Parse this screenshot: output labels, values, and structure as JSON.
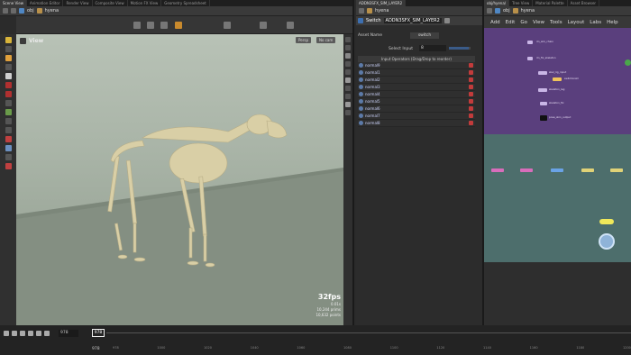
{
  "tabs_left": [
    "Scene View",
    "Animation Editor",
    "Render View",
    "Composite View",
    "Motion FX View",
    "Geometry Spreadsheet"
  ],
  "tabs_mid": [
    "ADDN3SFX_SIM_LAYER2"
  ],
  "tabs_right": [
    "obj/hyena/",
    "Tree View",
    "Material Palette",
    "Asset Browser"
  ],
  "left_path": [
    "obj",
    "hyena"
  ],
  "viewport": {
    "title": "View",
    "persp": "Persp",
    "cam": "No cam",
    "fps": "32fps",
    "time": "0.01s",
    "prims": "10,244 prims",
    "points": "10,632 points"
  },
  "mid_path": [
    "hyena"
  ],
  "param": {
    "node_type": "Switch",
    "node_name": "ADDN3SFX_SIM_LAYER2",
    "asset_label": "Asset Name",
    "asset_value": "switch",
    "select_label": "Select Input",
    "select_value": "8",
    "ops_header": "Input Operators (Drag/Drop to reorder)",
    "inputs": [
      "normal9",
      "normal1",
      "normal2",
      "normal3",
      "normal4",
      "normal5",
      "normal6",
      "normal7",
      "normal8"
    ]
  },
  "right_path": [
    "obj",
    "hyena"
  ],
  "menu": [
    "Add",
    "Edit",
    "Go",
    "View",
    "Tools",
    "Layout",
    "Labs",
    "Help"
  ],
  "graph_nodes": [
    "dn_sim_chain",
    "dn_fix_skeleton",
    "skel_rig_input",
    "switchAnim",
    "skeleton_leg",
    "skeleton_fix",
    "pose_skin_output"
  ],
  "timeline": {
    "frame_start": "978",
    "frame_cur": "978",
    "frame_end": "978",
    "ticks": [
      "978",
      "1000",
      "1020",
      "1040",
      "1060",
      "1080",
      "1100",
      "1120",
      "1140",
      "1160",
      "1180",
      "1200"
    ]
  },
  "colors": {
    "graph_purple": "#5a3f7d",
    "graph_teal": "#4d6e6c",
    "accent": "#f0b838"
  }
}
